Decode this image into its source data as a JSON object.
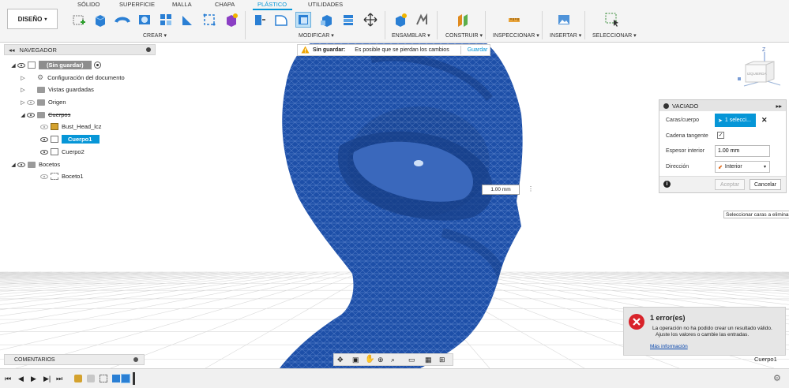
{
  "workspace": {
    "label": "DISEÑO"
  },
  "tabs": [
    "SÓLIDO",
    "SUPERFICIE",
    "MALLA",
    "CHAPA",
    "PLÁSTICO",
    "UTILIDADES"
  ],
  "active_tab": "PLÁSTICO",
  "groups": [
    "CREAR ▾",
    "MODIFICAR ▾",
    "ENSAMBLAR ▾",
    "CONSTRUIR ▾",
    "INSPECCIONAR ▾",
    "INSERTAR ▾",
    "SELECCIONAR ▾"
  ],
  "browser": {
    "title": "NAVEGADOR",
    "root": "(Sin guardar)",
    "settings": "Configuración del documento",
    "views": "Vistas guardadas",
    "origin": "Origen",
    "bodies": "Cuerpos",
    "body_items": [
      "Bust_Head_lcz",
      "Cuerpo1",
      "Cuerpo2"
    ],
    "sketches": "Bocetos",
    "sketch_items": [
      "Boceto1"
    ]
  },
  "unsaved": {
    "title": "Sin guardar:",
    "message": "Es posible que se pierdan los cambios",
    "save": "Guardar"
  },
  "viewcube": {
    "axis": "Z"
  },
  "dialog": {
    "title": "VACIADO",
    "faces_label": "Caras/cuerpo",
    "faces_value": "1 selecci...",
    "tangent_label": "Cadena tangente",
    "thickness_label": "Espesor interior",
    "thickness_value": "1.00 mm",
    "direction_label": "Dirección",
    "direction_value": "Interior",
    "ok": "Aceptar",
    "cancel": "Cancelar"
  },
  "tooltip": "Seleccionar caras a eliminar",
  "dimension": "1.00 mm",
  "error": {
    "title": "1 error(es)",
    "line1": "La operación no ha podido crear un resultado válido.",
    "line2": "Ajuste los valores o cambie las entradas.",
    "link": "Más información"
  },
  "comments": "COMENTARIOS",
  "status_body": "Cuerpo1",
  "colors": {
    "accent": "#0696d7",
    "model": "#1d4fa8",
    "mesh": "#5f86cc",
    "error": "#d8232a"
  }
}
